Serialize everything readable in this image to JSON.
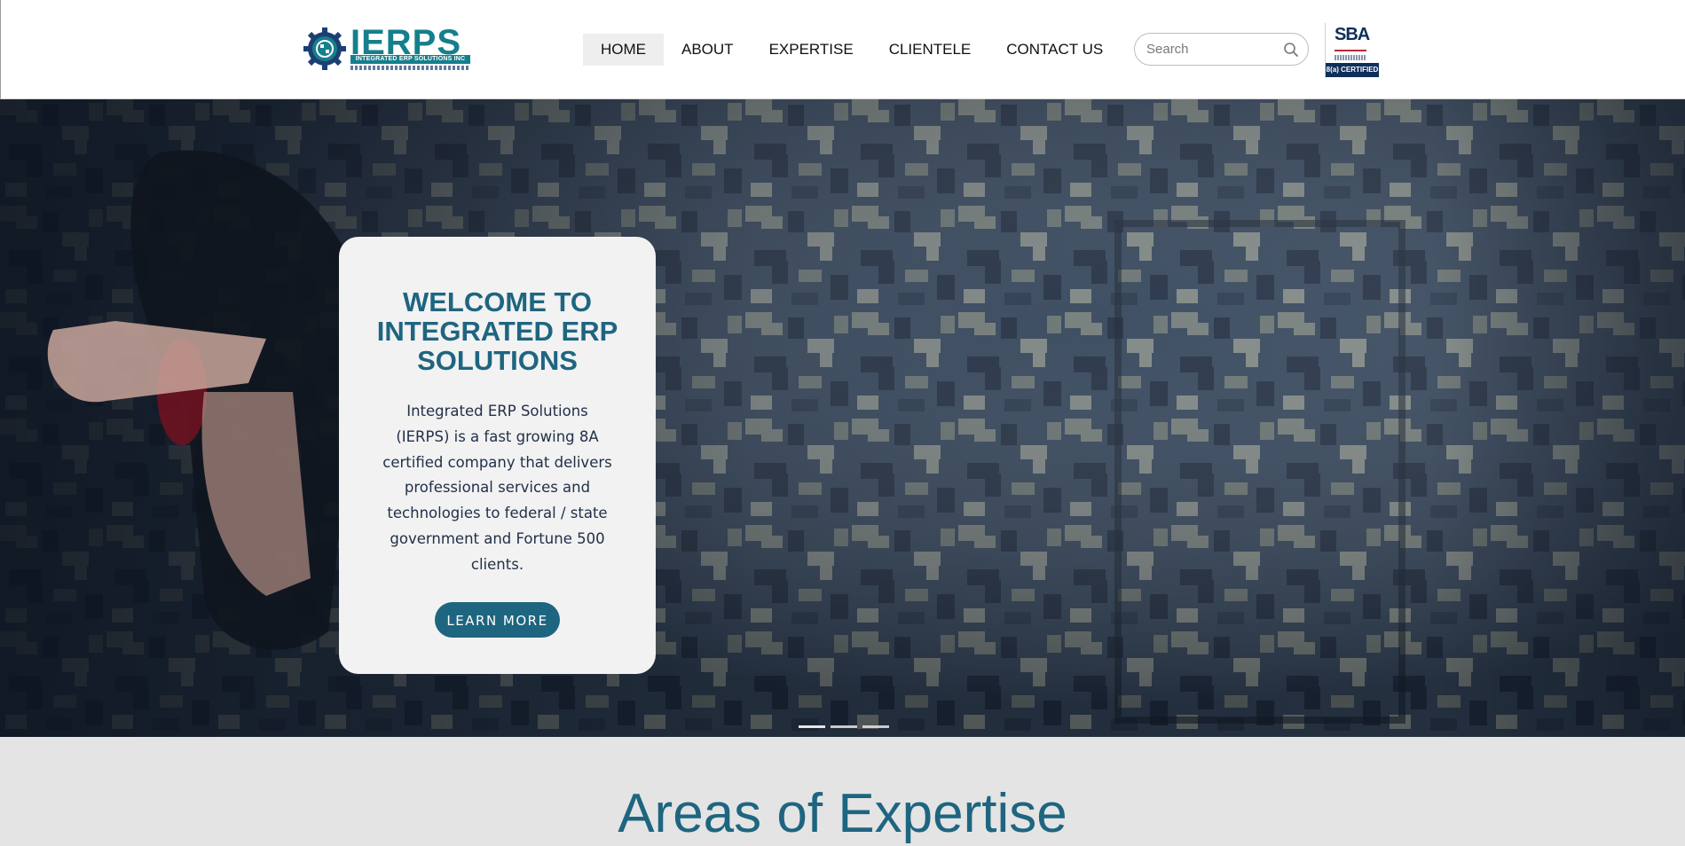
{
  "brand": {
    "logo_text": "IERPS",
    "logo_subtitle": "INTEGRATED ERP SOLUTIONS INC",
    "brand_color": "#157f8c"
  },
  "nav": {
    "items": [
      {
        "label": "HOME",
        "active": true
      },
      {
        "label": "ABOUT",
        "active": false
      },
      {
        "label": "EXPERTISE",
        "active": false
      },
      {
        "label": "CLIENTELE",
        "active": false
      },
      {
        "label": "CONTACT US",
        "active": false
      }
    ]
  },
  "search": {
    "placeholder": "Search",
    "icon": "search-icon"
  },
  "sba_badge": {
    "logo_text": "SBA",
    "badge_text": "8(a) CERTIFIED"
  },
  "hero": {
    "title": "WELCOME TO\nINTEGRATED ERP\nSOLUTIONS",
    "description": "Integrated ERP Solutions (IERPS) is a fast growing 8A certified company that delivers professional services and technologies to federal / state government and Fortune 500 clients.",
    "cta_label": "LEARN MORE",
    "accent_color": "#1e6580",
    "slides": [
      {
        "active": true
      },
      {
        "active": false
      },
      {
        "active": false
      }
    ]
  },
  "section": {
    "title": "Areas of Expertise"
  }
}
